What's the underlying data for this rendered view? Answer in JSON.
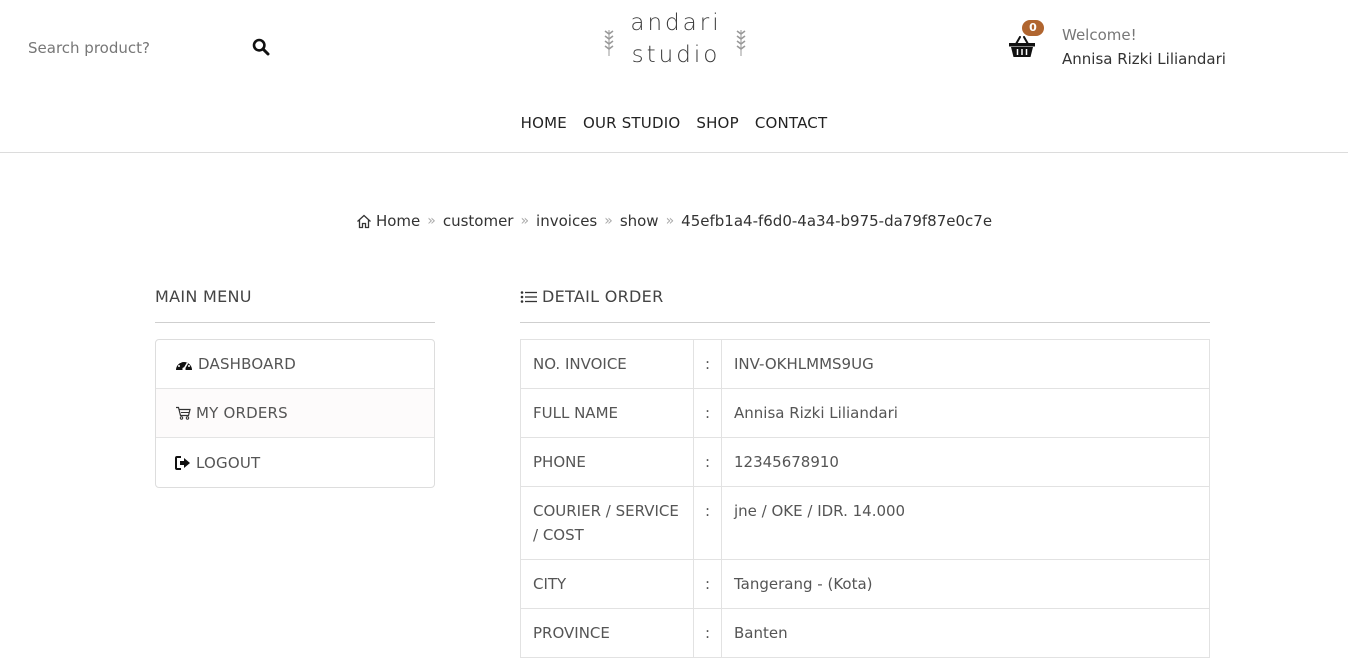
{
  "header": {
    "search": {
      "placeholder": "Search product?",
      "icon": "search-icon"
    },
    "logo": {
      "line1": "andari",
      "line2": "studio"
    },
    "cart": {
      "count": "0",
      "icon": "basket-icon",
      "badge_color": "#b0652f"
    },
    "welcome": "Welcome!",
    "username": "Annisa Rizki Liliandari"
  },
  "nav": {
    "items": [
      {
        "label": "HOME"
      },
      {
        "label": "OUR STUDIO"
      },
      {
        "label": "SHOP"
      },
      {
        "label": "CONTACT"
      }
    ]
  },
  "breadcrumb": {
    "home_icon": "home-icon",
    "items": [
      "Home",
      "customer",
      "invoices",
      "show",
      "45efb1a4-f6d0-4a34-b975-da79f87e0c7e"
    ],
    "separator": "»"
  },
  "sidebar": {
    "title": "MAIN MENU",
    "items": [
      {
        "label": "DASHBOARD",
        "icon": "dashboard-icon"
      },
      {
        "label": "MY ORDERS",
        "icon": "cart-icon"
      },
      {
        "label": "LOGOUT",
        "icon": "logout-icon"
      }
    ]
  },
  "detail": {
    "title": "DETAIL ORDER",
    "icon": "list-icon",
    "colon": ":",
    "rows": [
      {
        "key": "NO. INVOICE",
        "value": "INV-OKHLMMS9UG"
      },
      {
        "key": "FULL NAME",
        "value": "Annisa Rizki Liliandari"
      },
      {
        "key": "PHONE",
        "value": "12345678910"
      },
      {
        "key": "COURIER / SERVICE / COST",
        "value": "jne / OKE / IDR. 14.000"
      },
      {
        "key": "CITY",
        "value": "Tangerang - (Kota)"
      },
      {
        "key": "PROVINCE",
        "value": "Banten"
      }
    ]
  }
}
